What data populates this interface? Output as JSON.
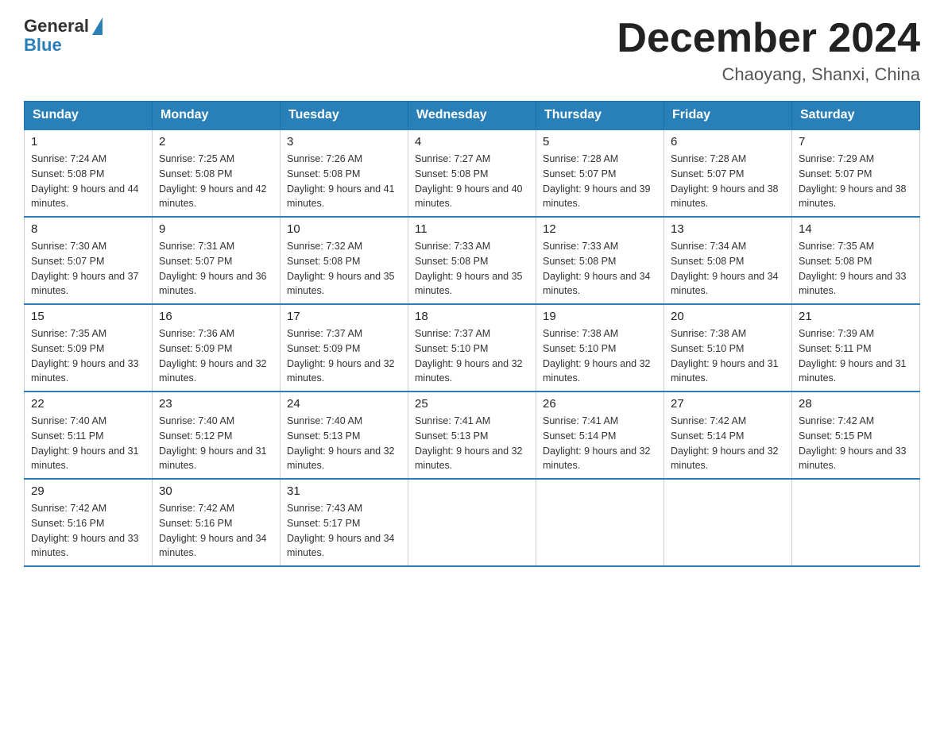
{
  "header": {
    "logo": {
      "general": "General",
      "blue": "Blue",
      "aria": "GeneralBlue logo"
    },
    "title": "December 2024",
    "location": "Chaoyang, Shanxi, China"
  },
  "days_of_week": [
    "Sunday",
    "Monday",
    "Tuesday",
    "Wednesday",
    "Thursday",
    "Friday",
    "Saturday"
  ],
  "weeks": [
    [
      {
        "day": "1",
        "sunrise": "Sunrise: 7:24 AM",
        "sunset": "Sunset: 5:08 PM",
        "daylight": "Daylight: 9 hours and 44 minutes."
      },
      {
        "day": "2",
        "sunrise": "Sunrise: 7:25 AM",
        "sunset": "Sunset: 5:08 PM",
        "daylight": "Daylight: 9 hours and 42 minutes."
      },
      {
        "day": "3",
        "sunrise": "Sunrise: 7:26 AM",
        "sunset": "Sunset: 5:08 PM",
        "daylight": "Daylight: 9 hours and 41 minutes."
      },
      {
        "day": "4",
        "sunrise": "Sunrise: 7:27 AM",
        "sunset": "Sunset: 5:08 PM",
        "daylight": "Daylight: 9 hours and 40 minutes."
      },
      {
        "day": "5",
        "sunrise": "Sunrise: 7:28 AM",
        "sunset": "Sunset: 5:07 PM",
        "daylight": "Daylight: 9 hours and 39 minutes."
      },
      {
        "day": "6",
        "sunrise": "Sunrise: 7:28 AM",
        "sunset": "Sunset: 5:07 PM",
        "daylight": "Daylight: 9 hours and 38 minutes."
      },
      {
        "day": "7",
        "sunrise": "Sunrise: 7:29 AM",
        "sunset": "Sunset: 5:07 PM",
        "daylight": "Daylight: 9 hours and 38 minutes."
      }
    ],
    [
      {
        "day": "8",
        "sunrise": "Sunrise: 7:30 AM",
        "sunset": "Sunset: 5:07 PM",
        "daylight": "Daylight: 9 hours and 37 minutes."
      },
      {
        "day": "9",
        "sunrise": "Sunrise: 7:31 AM",
        "sunset": "Sunset: 5:07 PM",
        "daylight": "Daylight: 9 hours and 36 minutes."
      },
      {
        "day": "10",
        "sunrise": "Sunrise: 7:32 AM",
        "sunset": "Sunset: 5:08 PM",
        "daylight": "Daylight: 9 hours and 35 minutes."
      },
      {
        "day": "11",
        "sunrise": "Sunrise: 7:33 AM",
        "sunset": "Sunset: 5:08 PM",
        "daylight": "Daylight: 9 hours and 35 minutes."
      },
      {
        "day": "12",
        "sunrise": "Sunrise: 7:33 AM",
        "sunset": "Sunset: 5:08 PM",
        "daylight": "Daylight: 9 hours and 34 minutes."
      },
      {
        "day": "13",
        "sunrise": "Sunrise: 7:34 AM",
        "sunset": "Sunset: 5:08 PM",
        "daylight": "Daylight: 9 hours and 34 minutes."
      },
      {
        "day": "14",
        "sunrise": "Sunrise: 7:35 AM",
        "sunset": "Sunset: 5:08 PM",
        "daylight": "Daylight: 9 hours and 33 minutes."
      }
    ],
    [
      {
        "day": "15",
        "sunrise": "Sunrise: 7:35 AM",
        "sunset": "Sunset: 5:09 PM",
        "daylight": "Daylight: 9 hours and 33 minutes."
      },
      {
        "day": "16",
        "sunrise": "Sunrise: 7:36 AM",
        "sunset": "Sunset: 5:09 PM",
        "daylight": "Daylight: 9 hours and 32 minutes."
      },
      {
        "day": "17",
        "sunrise": "Sunrise: 7:37 AM",
        "sunset": "Sunset: 5:09 PM",
        "daylight": "Daylight: 9 hours and 32 minutes."
      },
      {
        "day": "18",
        "sunrise": "Sunrise: 7:37 AM",
        "sunset": "Sunset: 5:10 PM",
        "daylight": "Daylight: 9 hours and 32 minutes."
      },
      {
        "day": "19",
        "sunrise": "Sunrise: 7:38 AM",
        "sunset": "Sunset: 5:10 PM",
        "daylight": "Daylight: 9 hours and 32 minutes."
      },
      {
        "day": "20",
        "sunrise": "Sunrise: 7:38 AM",
        "sunset": "Sunset: 5:10 PM",
        "daylight": "Daylight: 9 hours and 31 minutes."
      },
      {
        "day": "21",
        "sunrise": "Sunrise: 7:39 AM",
        "sunset": "Sunset: 5:11 PM",
        "daylight": "Daylight: 9 hours and 31 minutes."
      }
    ],
    [
      {
        "day": "22",
        "sunrise": "Sunrise: 7:40 AM",
        "sunset": "Sunset: 5:11 PM",
        "daylight": "Daylight: 9 hours and 31 minutes."
      },
      {
        "day": "23",
        "sunrise": "Sunrise: 7:40 AM",
        "sunset": "Sunset: 5:12 PM",
        "daylight": "Daylight: 9 hours and 31 minutes."
      },
      {
        "day": "24",
        "sunrise": "Sunrise: 7:40 AM",
        "sunset": "Sunset: 5:13 PM",
        "daylight": "Daylight: 9 hours and 32 minutes."
      },
      {
        "day": "25",
        "sunrise": "Sunrise: 7:41 AM",
        "sunset": "Sunset: 5:13 PM",
        "daylight": "Daylight: 9 hours and 32 minutes."
      },
      {
        "day": "26",
        "sunrise": "Sunrise: 7:41 AM",
        "sunset": "Sunset: 5:14 PM",
        "daylight": "Daylight: 9 hours and 32 minutes."
      },
      {
        "day": "27",
        "sunrise": "Sunrise: 7:42 AM",
        "sunset": "Sunset: 5:14 PM",
        "daylight": "Daylight: 9 hours and 32 minutes."
      },
      {
        "day": "28",
        "sunrise": "Sunrise: 7:42 AM",
        "sunset": "Sunset: 5:15 PM",
        "daylight": "Daylight: 9 hours and 33 minutes."
      }
    ],
    [
      {
        "day": "29",
        "sunrise": "Sunrise: 7:42 AM",
        "sunset": "Sunset: 5:16 PM",
        "daylight": "Daylight: 9 hours and 33 minutes."
      },
      {
        "day": "30",
        "sunrise": "Sunrise: 7:42 AM",
        "sunset": "Sunset: 5:16 PM",
        "daylight": "Daylight: 9 hours and 34 minutes."
      },
      {
        "day": "31",
        "sunrise": "Sunrise: 7:43 AM",
        "sunset": "Sunset: 5:17 PM",
        "daylight": "Daylight: 9 hours and 34 minutes."
      },
      null,
      null,
      null,
      null
    ]
  ]
}
